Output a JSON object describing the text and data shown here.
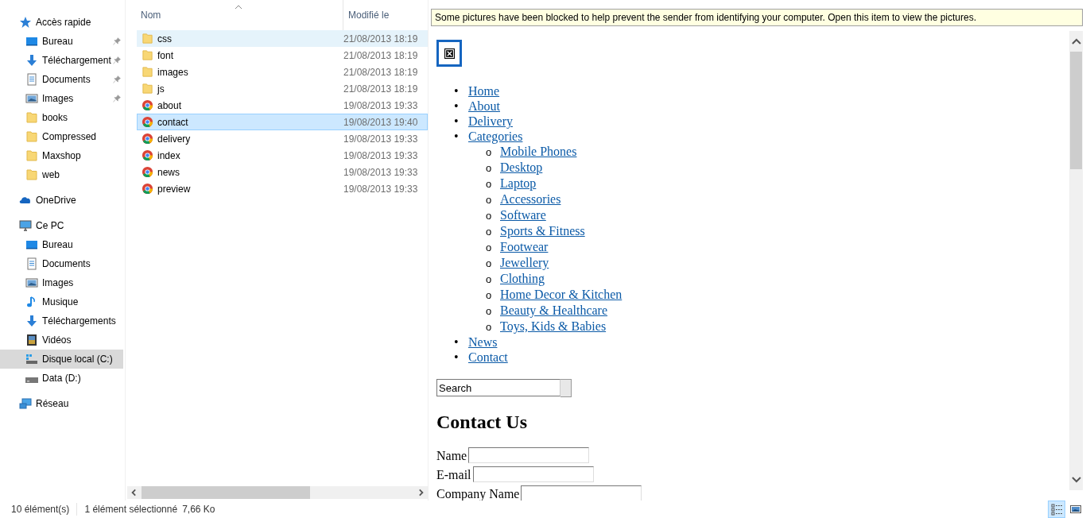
{
  "sidebar": {
    "sections": [
      {
        "label": "Accès rapide",
        "kind": "star",
        "selected": false,
        "children": [
          {
            "label": "Bureau",
            "kind": "desktop",
            "pinned": true,
            "selected": false
          },
          {
            "label": "Téléchargement",
            "kind": "download",
            "pinned": true,
            "selected": false
          },
          {
            "label": "Documents",
            "kind": "document",
            "pinned": true,
            "selected": false
          },
          {
            "label": "Images",
            "kind": "image",
            "pinned": true,
            "selected": false
          },
          {
            "label": "books",
            "kind": "folder",
            "pinned": false,
            "selected": false
          },
          {
            "label": "Compressed",
            "kind": "folder",
            "pinned": false,
            "selected": false
          },
          {
            "label": "Maxshop",
            "kind": "folder",
            "pinned": false,
            "selected": false
          },
          {
            "label": "web",
            "kind": "folder",
            "pinned": false,
            "selected": false
          }
        ]
      },
      {
        "label": "OneDrive",
        "kind": "cloud",
        "selected": false
      },
      {
        "label": "Ce PC",
        "kind": "pc",
        "selected": false,
        "children": [
          {
            "label": "Bureau",
            "kind": "desktop",
            "pinned": false,
            "selected": false
          },
          {
            "label": "Documents",
            "kind": "document",
            "pinned": false,
            "selected": false
          },
          {
            "label": "Images",
            "kind": "image",
            "pinned": false,
            "selected": false
          },
          {
            "label": "Musique",
            "kind": "music",
            "pinned": false,
            "selected": false
          },
          {
            "label": "Téléchargements",
            "kind": "download",
            "pinned": false,
            "selected": false
          },
          {
            "label": "Vidéos",
            "kind": "video",
            "pinned": false,
            "selected": false
          },
          {
            "label": "Disque local (C:)",
            "kind": "systemdrive",
            "pinned": false,
            "selected": true
          },
          {
            "label": "Data (D:)",
            "kind": "drive",
            "pinned": false,
            "selected": false
          }
        ]
      },
      {
        "label": "Réseau",
        "kind": "network",
        "selected": false
      }
    ]
  },
  "file_list": {
    "columns": [
      "Nom",
      "Modifié le"
    ],
    "rows": [
      {
        "name": "css",
        "modified": "21/08/2013 18:19",
        "kind": "folder",
        "selected": false,
        "hovered": true
      },
      {
        "name": "font",
        "modified": "21/08/2013 18:19",
        "kind": "folder",
        "selected": false,
        "hovered": false
      },
      {
        "name": "images",
        "modified": "21/08/2013 18:19",
        "kind": "folder",
        "selected": false,
        "hovered": false
      },
      {
        "name": "js",
        "modified": "21/08/2013 18:19",
        "kind": "folder",
        "selected": false,
        "hovered": false
      },
      {
        "name": "about",
        "modified": "19/08/2013 19:33",
        "kind": "html",
        "selected": false,
        "hovered": false
      },
      {
        "name": "contact",
        "modified": "19/08/2013 19:40",
        "kind": "html",
        "selected": true,
        "hovered": false
      },
      {
        "name": "delivery",
        "modified": "19/08/2013 19:33",
        "kind": "html",
        "selected": false,
        "hovered": false
      },
      {
        "name": "index",
        "modified": "19/08/2013 19:33",
        "kind": "html",
        "selected": false,
        "hovered": false
      },
      {
        "name": "news",
        "modified": "19/08/2013 19:33",
        "kind": "html",
        "selected": false,
        "hovered": false
      },
      {
        "name": "preview",
        "modified": "19/08/2013 19:33",
        "kind": "html",
        "selected": false,
        "hovered": false
      }
    ]
  },
  "preview": {
    "info_bar": "Some pictures have been blocked to help prevent the sender from identifying your computer. Open this item to view the pictures.",
    "nav": [
      {
        "marker": "•",
        "label": "Home"
      },
      {
        "marker": "•",
        "label": "About"
      },
      {
        "marker": "•",
        "label": "Delivery"
      },
      {
        "marker": "•",
        "label": "Categories",
        "children": [
          {
            "marker": "o",
            "label": "Mobile Phones"
          },
          {
            "marker": "o",
            "label": "Desktop"
          },
          {
            "marker": "o",
            "label": "Laptop"
          },
          {
            "marker": "o",
            "label": "Accessories"
          },
          {
            "marker": "o",
            "label": "Software"
          },
          {
            "marker": "o",
            "label": "Sports & Fitness"
          },
          {
            "marker": "o",
            "label": "Footwear"
          },
          {
            "marker": "o",
            "label": "Jewellery"
          },
          {
            "marker": "o",
            "label": "Clothing"
          },
          {
            "marker": "o",
            "label": "Home Decor & Kitchen"
          },
          {
            "marker": "o",
            "label": "Beauty & Healthcare"
          },
          {
            "marker": "o",
            "label": "Toys, Kids & Babies"
          }
        ]
      },
      {
        "marker": "•",
        "label": "News"
      },
      {
        "marker": "•",
        "label": "Contact"
      }
    ],
    "search": {
      "value": "Search"
    },
    "heading": "Contact Us",
    "fields": [
      {
        "label": "Name"
      },
      {
        "label": "E-mail"
      },
      {
        "label": "Company Name"
      }
    ]
  },
  "status_bar": {
    "count": "10 élément(s)",
    "selection": "1 élément sélectionné",
    "size": "7,66 Ko",
    "views": [
      {
        "kind": "details",
        "selected": true
      },
      {
        "kind": "thumbnails",
        "selected": false
      }
    ]
  }
}
